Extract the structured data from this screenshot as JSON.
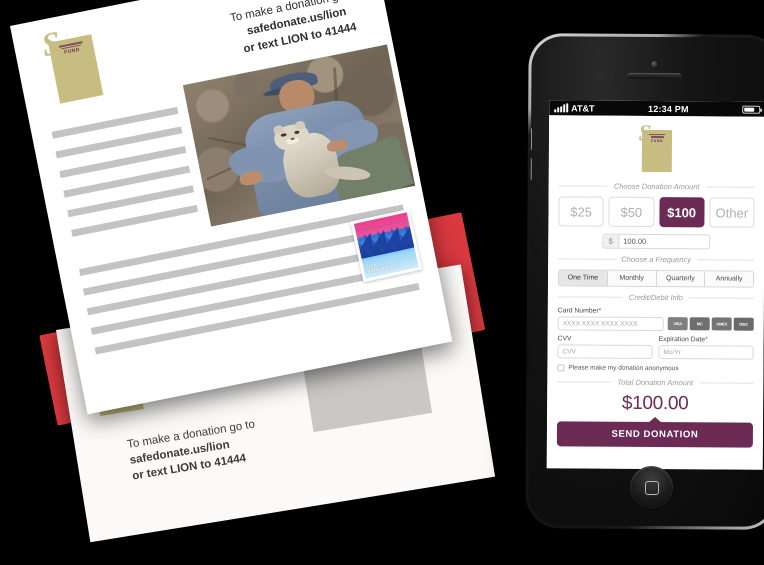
{
  "mailer": {
    "headline_line1": "To make a donation go to",
    "headline_line2": "safedonate.us/lion",
    "headline_line3": "or text LION to 41444",
    "back_line1": "To make a donation go to",
    "back_line2": "safedonate.us/lion",
    "back_line3": "or text LION to 41444",
    "logo": {
      "glyph": "S",
      "word": "FUND",
      "plate_color": "#6b2b55",
      "background_color": "#c7bd80"
    },
    "photo_alt": "wildlife-ranger-holding-mountain-lion-cub",
    "stamp": {
      "caption_line1": "USA",
      "caption_line2": "FOREVER 2012"
    }
  },
  "phone": {
    "statusbar": {
      "carrier": "AT&T",
      "time": "12:34 PM",
      "signal_icon": "signal-bars-icon",
      "battery_icon": "battery-icon"
    },
    "home_button_icon": "home-square-icon",
    "camera_icon": "front-camera-icon",
    "speaker_icon": "earpiece-speaker-icon"
  },
  "app": {
    "logo": {
      "glyph": "S",
      "word": "FUND"
    },
    "amount_section_title": "Choose Donation Amount",
    "amount_options": [
      {
        "label": "$25",
        "selected": false
      },
      {
        "label": "$50",
        "selected": false
      },
      {
        "label": "$100",
        "selected": true
      },
      {
        "label": "Other",
        "selected": false
      }
    ],
    "amount_input": {
      "prefix": "$",
      "value": "100.00",
      "placeholder": "0.00"
    },
    "frequency_section_title": "Choose a Frequency",
    "frequency_options": [
      {
        "label": "One Time",
        "active": true
      },
      {
        "label": "Monthly",
        "active": false
      },
      {
        "label": "Quarterly",
        "active": false
      },
      {
        "label": "Annually",
        "active": false
      }
    ],
    "card_section_title": "Credit/Debit Info",
    "card_number_label": "Card Number",
    "card_number_required": "*",
    "card_number_placeholder": "XXXX XXXX XXXX XXXX",
    "card_brands": [
      {
        "name": "visa-icon",
        "label": "VISA"
      },
      {
        "name": "mastercard-icon",
        "label": "MasterCard"
      },
      {
        "name": "amex-icon",
        "label": "AMERICAN EXPRESS"
      },
      {
        "name": "discover-icon",
        "label": "DISCOVER"
      }
    ],
    "cvv_label": "CVV",
    "cvv_placeholder": "CVV",
    "expiration_label": "Expiration Date",
    "expiration_required": "*",
    "expiration_placeholder": "Mo/Yr",
    "anonymous_label": "Please make my donation anonymous",
    "anonymous_checked": false,
    "total_section_title": "Total Donation Amount",
    "total_amount": "$100.00",
    "send_button_label": "SEND DONATION",
    "accent_color": "#6b2b55"
  }
}
